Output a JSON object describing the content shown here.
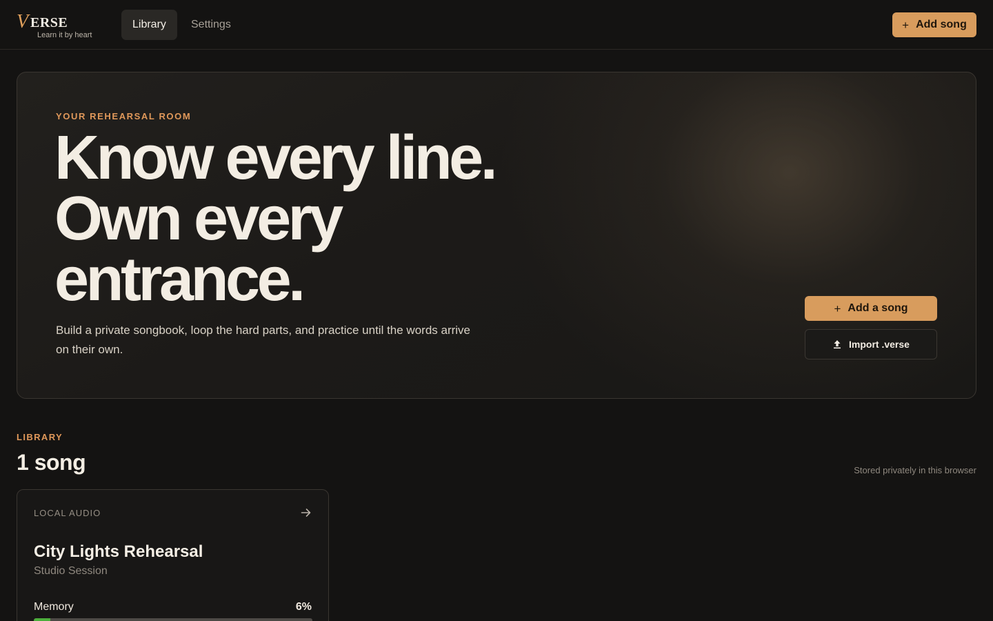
{
  "app": {
    "logo_mark": "V",
    "logo_word": "ERSE",
    "tagline": "Learn it by heart"
  },
  "nav": {
    "tabs": [
      {
        "label": "Library",
        "active": true
      },
      {
        "label": "Settings",
        "active": false
      }
    ],
    "add_song_label": "Add song"
  },
  "hero": {
    "eyebrow": "YOUR REHEARSAL ROOM",
    "headline_lines": [
      "Know every line.",
      "Own every",
      "entrance."
    ],
    "subtitle": "Build a private songbook, loop the hard parts, and practice until the words arrive on their own.",
    "add_label": "Add a song",
    "import_label": "Import .verse"
  },
  "library": {
    "eyebrow": "LIBRARY",
    "count_label": "1 song",
    "storage_note": "Stored privately in this browser",
    "songs": [
      {
        "source": "LOCAL AUDIO",
        "title": "City Lights Rehearsal",
        "artist": "Studio Session",
        "memory_label": "Memory",
        "memory_value": "6%",
        "memory_fraction": 0.06
      }
    ]
  },
  "colors": {
    "accent": "#d89c5d",
    "eyebrow": "#e0985a",
    "background": "#141312",
    "progress_fill": "#4caf3c"
  },
  "icons": [
    "plus-icon",
    "upload-icon",
    "arrow-right-icon"
  ]
}
